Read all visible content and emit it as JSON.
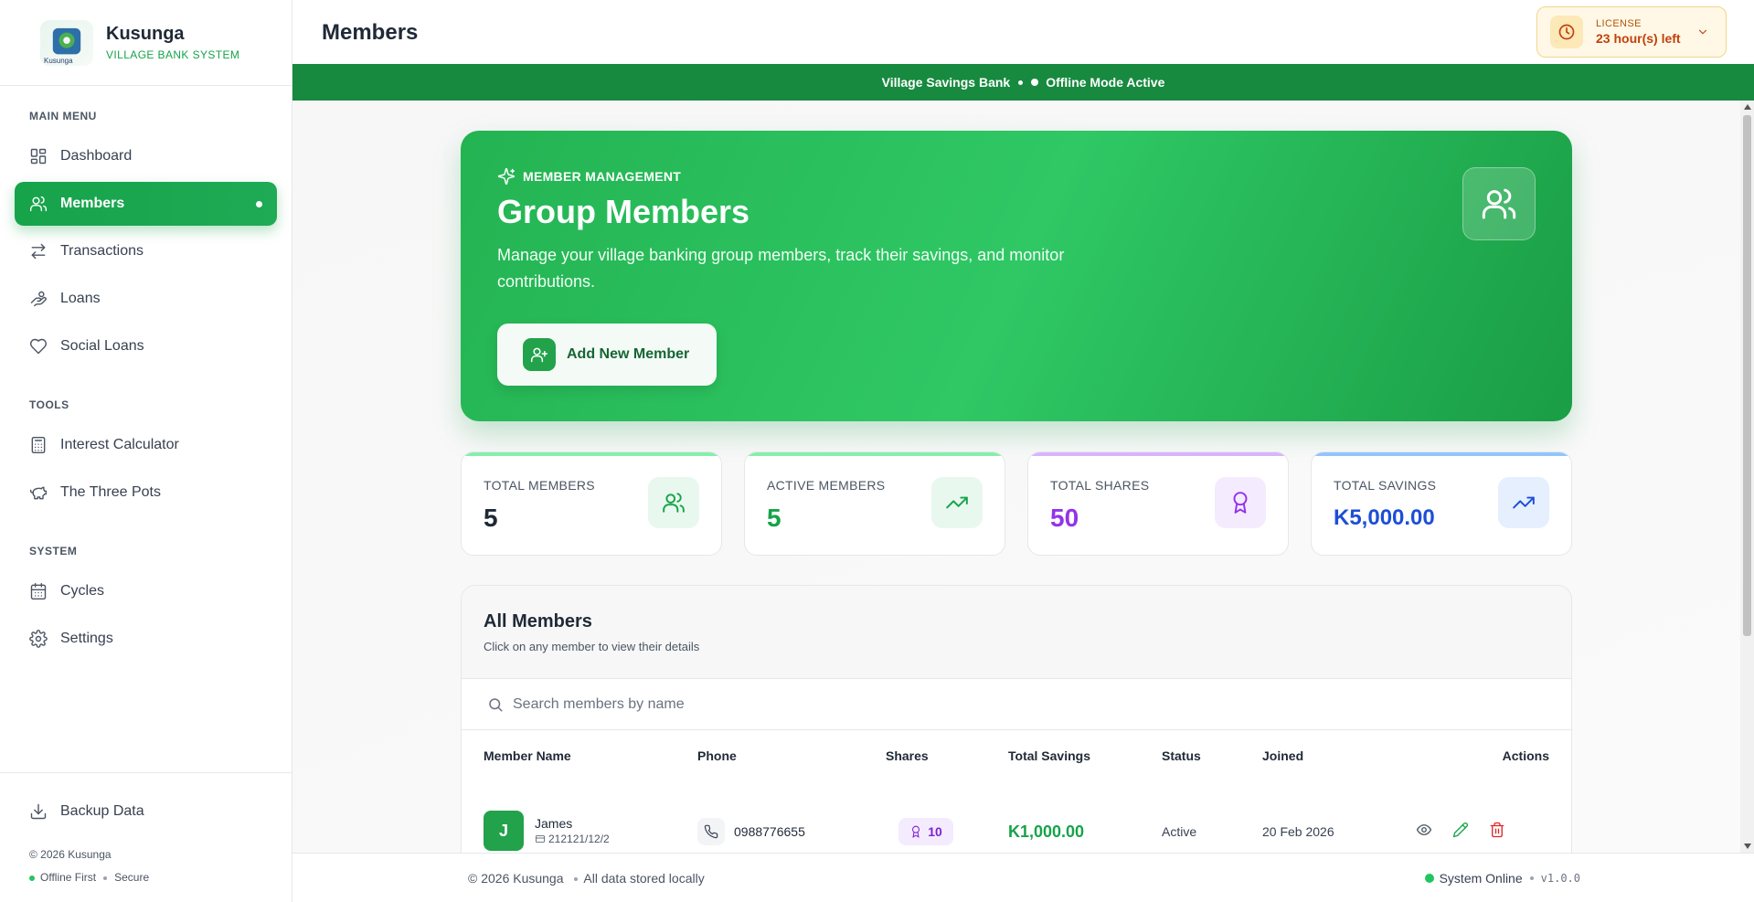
{
  "brand": {
    "name": "Kusunga",
    "subtitle": "VILLAGE BANK SYSTEM",
    "logo_caption": "Kusunga"
  },
  "sidebar": {
    "main_menu_label": "MAIN MENU",
    "tools_label": "TOOLS",
    "system_label": "SYSTEM",
    "items": [
      {
        "label": "Dashboard",
        "icon": "dashboard-icon"
      },
      {
        "label": "Members",
        "icon": "users-icon",
        "active": true
      },
      {
        "label": "Transactions",
        "icon": "arrows-icon"
      },
      {
        "label": "Loans",
        "icon": "hand-coins-icon"
      },
      {
        "label": "Social Loans",
        "icon": "heart-icon"
      },
      {
        "label": "Interest Calculator",
        "icon": "calculator-icon"
      },
      {
        "label": "The Three Pots",
        "icon": "piggy-bank-icon"
      },
      {
        "label": "Cycles",
        "icon": "calendar-icon"
      },
      {
        "label": "Settings",
        "icon": "gear-icon"
      }
    ],
    "backup_label": "Backup Data",
    "copyright": "© 2026 Kusunga",
    "foot_offline": "Offline First",
    "foot_secure": "Secure"
  },
  "header": {
    "title": "Members",
    "license_label": "LICENSE",
    "license_value": "23 hour(s) left"
  },
  "banner": {
    "bank": "Village Savings Bank",
    "mode": "Offline Mode Active"
  },
  "hero": {
    "eyebrow": "MEMBER MANAGEMENT",
    "title": "Group Members",
    "description": "Manage your village banking group members, track their savings, and monitor contributions.",
    "button": "Add New Member"
  },
  "stats": [
    {
      "label": "TOTAL MEMBERS",
      "value": "5",
      "color": "#1f2937",
      "accent": "#86efac",
      "icon_bg": "#e8f8ee",
      "icon_color": "#16a34a"
    },
    {
      "label": "ACTIVE MEMBERS",
      "value": "5",
      "color": "#16a34a",
      "accent": "#86efac",
      "icon_bg": "#e8f8ee",
      "icon_color": "#16a34a"
    },
    {
      "label": "TOTAL SHARES",
      "value": "50",
      "color": "#9333ea",
      "accent": "#d8b4fe",
      "icon_bg": "#f5ebff",
      "icon_color": "#9333ea"
    },
    {
      "label": "TOTAL SAVINGS",
      "value": "K5,000.00",
      "color": "#1d4ed8",
      "accent": "#93c5fd",
      "icon_bg": "#e6effe",
      "icon_color": "#1d4ed8"
    }
  ],
  "members": {
    "title": "All Members",
    "subtitle": "Click on any member to view their details",
    "search_placeholder": "Search members by name",
    "columns": [
      "Member Name",
      "Phone",
      "Shares",
      "Total Savings",
      "Status",
      "Joined",
      "Actions"
    ],
    "rows": [
      {
        "initial": "J",
        "name": "James",
        "id": "212121/12/2",
        "phone": "0988776655",
        "shares": "10",
        "savings": "K1,000.00",
        "status": "Active",
        "joined": "20 Feb 2026"
      }
    ]
  },
  "footer": {
    "copyright": "© 2026 Kusunga",
    "storage": "All data stored locally",
    "status": "System Online",
    "version": "v1.0.0"
  }
}
